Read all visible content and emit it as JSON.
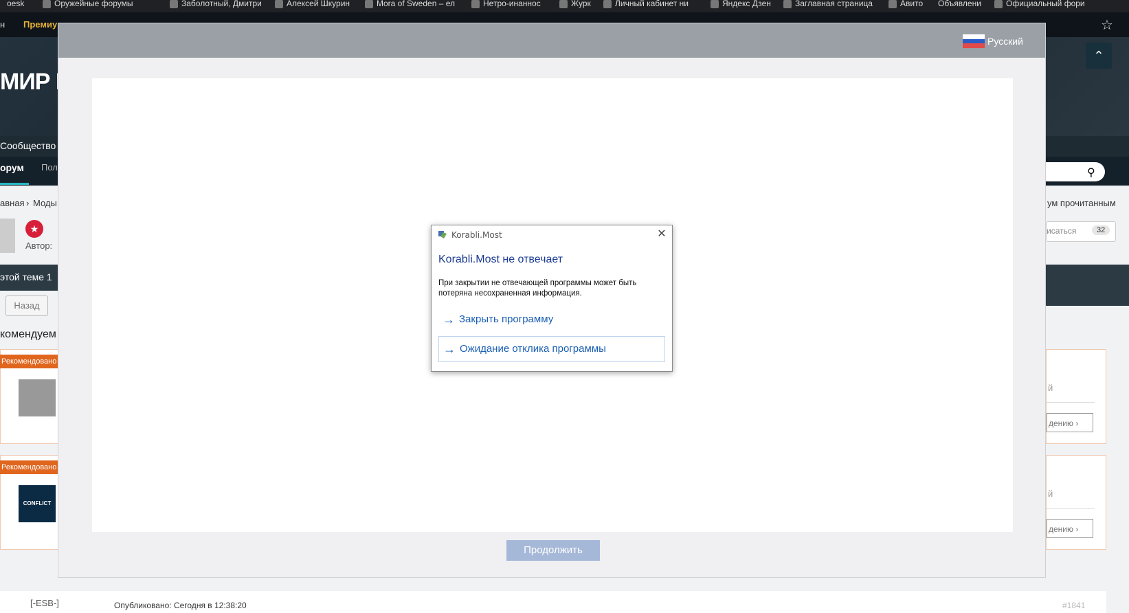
{
  "browser": {
    "bookmarks": [
      {
        "label": "oesk"
      },
      {
        "label": "Оружейные форумы"
      },
      {
        "label": "Заболотный, Дмитри"
      },
      {
        "label": "Алексей Шкурин"
      },
      {
        "label": "Mora of Sweden – ел"
      },
      {
        "label": "Нетро-инаннос"
      },
      {
        "label": "Журк"
      },
      {
        "label": "Личный кабинет ни"
      },
      {
        "label": "Яндекс Дзен"
      },
      {
        "label": "Заглавная страница"
      },
      {
        "label": "Авито"
      },
      {
        "label": "Объявлени"
      },
      {
        "label": "Официальный фори"
      }
    ]
  },
  "site": {
    "nav_left": "н",
    "premium": "Премиу",
    "logo": "МИР К",
    "community": "Сообщество",
    "forum_tab": "орум",
    "polls_tab": "Пол",
    "breadcrumb_1": "авная",
    "breadcrumb_2": "Моды",
    "mark_read": "ум прочитанным",
    "topic_author": "Автор:",
    "in_topic": "этой теме 1",
    "back": "Назад",
    "recommended": "комендуем",
    "badge_recommended": "Рекомендовано",
    "follow": "исаться",
    "follow_count": "32",
    "rec_side_1": "й",
    "rec_link_1": "дению ›",
    "rec_side_2": "й",
    "rec_link_2": "дению ›",
    "post_author": "[-ESB-]",
    "post_date": "Опубликовано: Сегодня в 12:38:20",
    "post_num": "#1841",
    "scroll_top_icon": "chevron-up-icon"
  },
  "modal": {
    "language": "Русский",
    "continue_label": "Продолжить"
  },
  "dialog": {
    "app_title": "Korabli.Most",
    "heading": "Korabli.Most не отвечает",
    "message": "При закрытии не отвечающей программы может быть потеряна несохраненная информация.",
    "options": [
      {
        "label": "Закрыть программу"
      },
      {
        "label": "Ожидание отклика программы"
      }
    ],
    "close_icon": "close-icon",
    "colors": {
      "heading": "#1a3b94",
      "link": "#1a5fb4"
    }
  }
}
